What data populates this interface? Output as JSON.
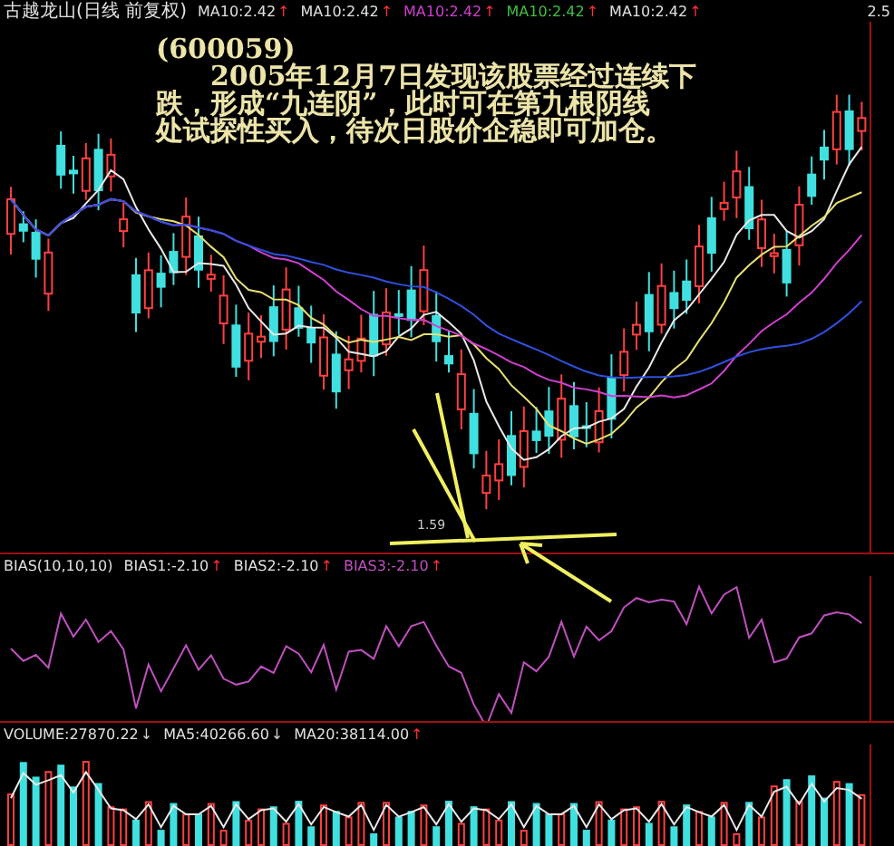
{
  "header": {
    "title": "古越龙山(日线 前复权)",
    "indicators": [
      {
        "label": "MA10:2.42",
        "arrow": {
          "symbol": "↑",
          "color": "#ff3030"
        },
        "color": "#e0e0e0"
      },
      {
        "label": "MA10:2.42",
        "arrow": {
          "symbol": "↑",
          "color": "#ff3030"
        },
        "color": "#e0e0e0"
      },
      {
        "label": "MA10:2.42",
        "arrow": {
          "symbol": "↑",
          "color": "#ff3030"
        },
        "color": "#d040d0"
      },
      {
        "label": "MA10:2.42",
        "arrow": {
          "symbol": "↑",
          "color": "#ff3030"
        },
        "color": "#40c040"
      },
      {
        "label": "MA10:2.42",
        "arrow": {
          "symbol": "↑",
          "color": "#ff3030"
        },
        "color": "#e0e0e0"
      }
    ],
    "axis_label": "2.5"
  },
  "note": {
    "code": "(600059)",
    "lines": [
      "2005年12月7日发现该股票经过连续下",
      "跌，形成“九连阴”，此时可在第九根阴线",
      "处试探性买入，待次日股价企稳即可加仓。"
    ]
  },
  "price_marker": "1.59",
  "bias": {
    "title": "BIAS(10,10,10)",
    "indicators": [
      {
        "label": "BIAS1:-2.10",
        "arrow": {
          "symbol": "↑",
          "color": "#ff3030"
        },
        "color": "#e0e0e0"
      },
      {
        "label": "BIAS2:-2.10",
        "arrow": {
          "symbol": "↑",
          "color": "#ff3030"
        },
        "color": "#e0e0e0"
      },
      {
        "label": "BIAS3:-2.10",
        "arrow": {
          "symbol": "↑",
          "color": "#ff3030"
        },
        "color": "#c050c0"
      }
    ]
  },
  "volume": {
    "title": "VOLUME:27870.22",
    "arrow": {
      "symbol": "↓",
      "color": "#d0d0d0"
    },
    "indicators": [
      {
        "label": "MA5:40266.60",
        "arrow": {
          "symbol": "↓",
          "color": "#d0d0d0"
        },
        "color": "#e0e0e0"
      },
      {
        "label": "MA20:38114.00",
        "arrow": {
          "symbol": "↑",
          "color": "#ff3030"
        },
        "color": "#e0e0e0"
      }
    ]
  }
}
